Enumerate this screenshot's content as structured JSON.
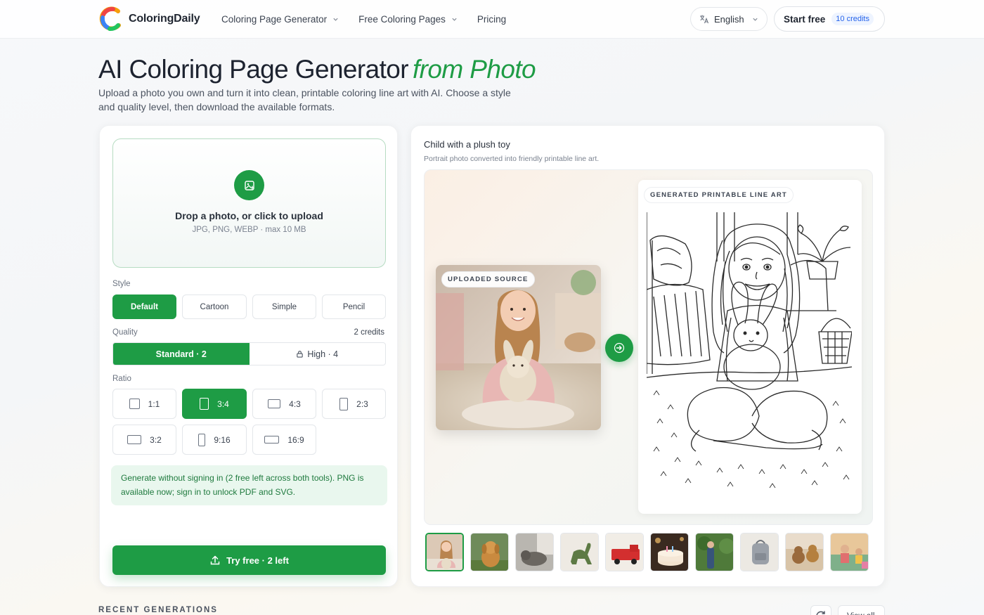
{
  "header": {
    "brand": "ColoringDaily",
    "nav": [
      {
        "label": "Coloring Page Generator",
        "dropdown": true
      },
      {
        "label": "Free Coloring Pages",
        "dropdown": true
      },
      {
        "label": "Pricing",
        "dropdown": false
      }
    ],
    "language": "English",
    "start_label": "Start free",
    "credits": "10 credits"
  },
  "hero": {
    "title": "AI Coloring Page Generator",
    "title_accent": "from Photo",
    "subtitle": "Upload a photo you own and turn it into clean, printable coloring line art with AI. Choose a style and quality level, then download the available formats."
  },
  "upload": {
    "title": "Drop a photo, or click to upload",
    "hint": "JPG, PNG, WEBP · max 10 MB"
  },
  "style": {
    "label": "Style",
    "options": [
      "Default",
      "Cartoon",
      "Simple",
      "Pencil"
    ],
    "selected": "Default"
  },
  "quality": {
    "label": "Quality",
    "cost": "2 credits",
    "options": [
      "Standard · 2",
      "High · 4"
    ],
    "selected": "Standard · 2"
  },
  "ratio": {
    "label": "Ratio",
    "options": [
      "1:1",
      "3:4",
      "4:3",
      "2:3",
      "3:2",
      "9:16",
      "16:9"
    ],
    "selected": "3:4"
  },
  "notice": "Generate without signing in (2 free left across both tools). PNG is available now; sign in to unlock PDF and SVG.",
  "cta": "Try free · 2 left",
  "example": {
    "title": "Child with a plush toy",
    "subtitle": "Portrait photo converted into friendly printable line art.",
    "source_tag": "UPLOADED SOURCE",
    "result_tag": "GENERATED PRINTABLE LINE ART"
  },
  "thumbnails": [
    "girl-with-plush",
    "golden-retriever",
    "sleeping-cat",
    "toy-dinosaur",
    "red-fire-truck",
    "birthday-cake",
    "garden-path",
    "school-backpack",
    "teddy-bears",
    "kids-playing"
  ],
  "recent": {
    "label": "RECENT GENERATIONS",
    "view_all": "View all"
  },
  "colors": {
    "brand_green": "#1e9c45",
    "credit_blue": "#2563eb"
  }
}
